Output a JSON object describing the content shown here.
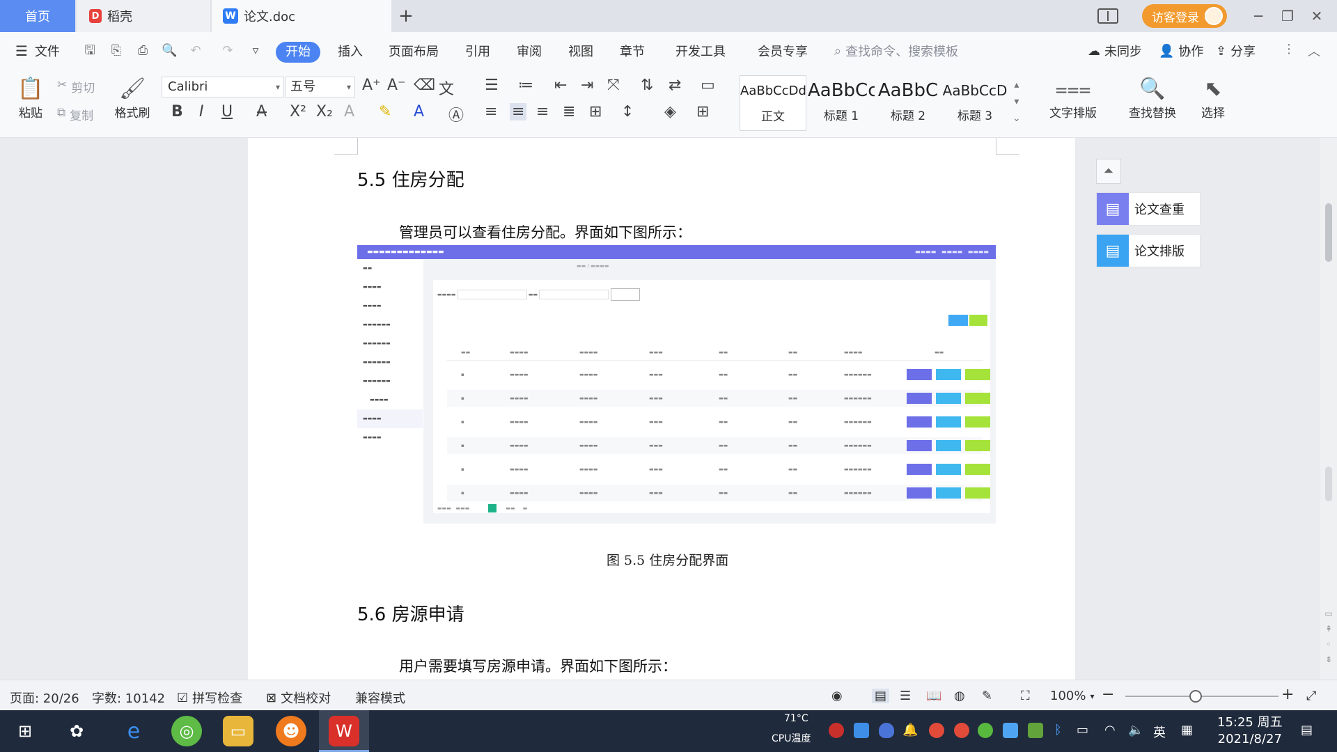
{
  "tabs": {
    "home": "首页",
    "daoke": "稻壳",
    "doc": "论文.doc",
    "add": "+"
  },
  "titlebar": {
    "login": "访客登录",
    "minimize": "─",
    "restore": "❐",
    "close": "✕"
  },
  "menu": {
    "file": "文件",
    "start": "开始",
    "items": [
      "插入",
      "页面布局",
      "引用",
      "审阅",
      "视图",
      "章节",
      "开发工具",
      "会员专享"
    ],
    "search": "查找命令、搜索模板",
    "sync": "未同步",
    "collab": "协作",
    "share": "分享"
  },
  "ribbon": {
    "paste": "粘贴",
    "cut": "剪切",
    "copy": "复制",
    "format_painter": "格式刷",
    "font_name": "Calibri",
    "font_size": "五号",
    "styles": [
      {
        "sample": "AaBbCcDd",
        "name": "正文"
      },
      {
        "sample": "AaBbCc",
        "name": "标题 1"
      },
      {
        "sample": "AaBbC",
        "name": "标题 2"
      },
      {
        "sample": "AaBbCcD",
        "name": "标题 3"
      }
    ],
    "text_layout": "文字排版",
    "find_replace": "查找替换",
    "select": "选择"
  },
  "document": {
    "sec55_title": "5.5  住房分配",
    "sec55_para": "管理员可以查看住房分配。界面如下图所示：",
    "figure_caption": "图 5.5  住房分配界面",
    "sec56_title": "5.6  房源申请",
    "sec56_para": "用户需要填写房源申请。界面如下图所示："
  },
  "side_panel": {
    "check": "论文查重",
    "layout": "论文排版"
  },
  "statusbar": {
    "page": "页面: 20/26",
    "words": "字数: 10142",
    "spell": "拼写检查",
    "proof": "文档校对",
    "compat": "兼容模式",
    "zoom": "100%"
  },
  "taskbar": {
    "cpu_temp": "71°C",
    "cpu_label": "CPU温度",
    "ime": "英",
    "time": "15:25 周五",
    "date": "2021/8/27"
  },
  "colors": {
    "accent": "#4b84f2",
    "login": "#f29a2e",
    "shot_header": "#6c6fe8"
  }
}
